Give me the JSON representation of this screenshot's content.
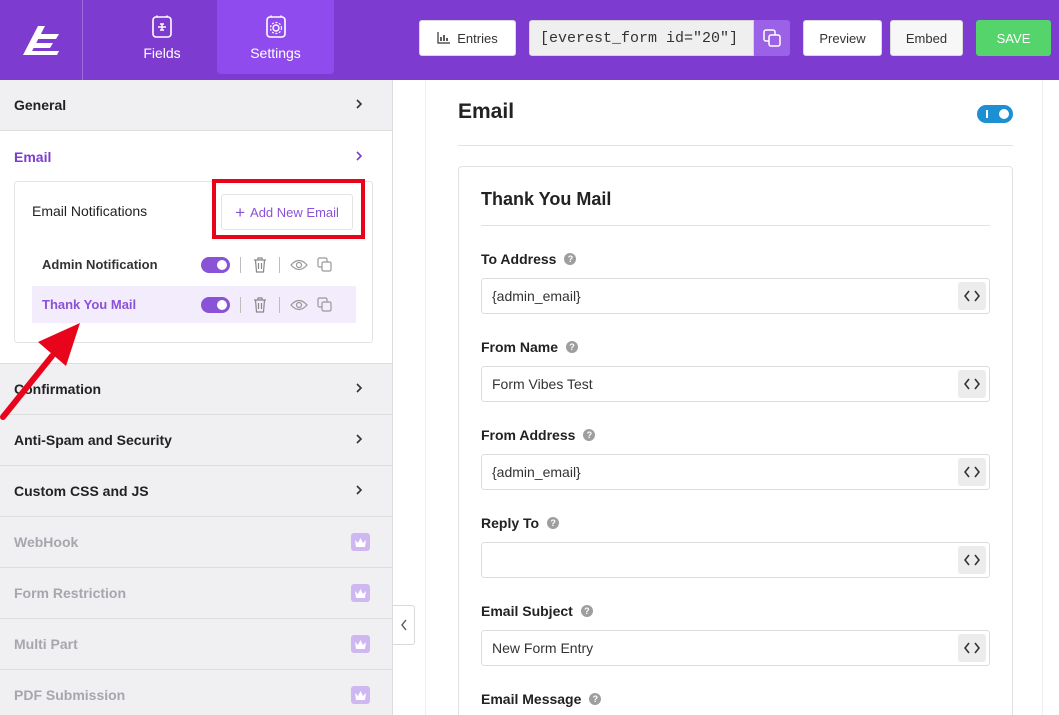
{
  "topbar": {
    "tabs": [
      {
        "label": "Fields",
        "icon": "form-fields-icon"
      },
      {
        "label": "Settings",
        "icon": "settings-doc-icon"
      }
    ],
    "entries_label": "Entries",
    "shortcode": "[everest_form id=\"20\"]",
    "preview_label": "Preview",
    "embed_label": "Embed",
    "save_label": "SAVE"
  },
  "sidebar": {
    "items": [
      {
        "label": "General"
      },
      {
        "label": "Email"
      },
      {
        "label": "Confirmation"
      },
      {
        "label": "Anti-Spam and Security"
      },
      {
        "label": "Custom CSS and JS"
      },
      {
        "label": "WebHook"
      },
      {
        "label": "Form Restriction"
      },
      {
        "label": "Multi Part"
      },
      {
        "label": "PDF Submission"
      }
    ],
    "email_notifications": {
      "title": "Email Notifications",
      "add_label": "Add New Email",
      "rows": [
        {
          "label": "Admin Notification",
          "enabled": true
        },
        {
          "label": "Thank You Mail",
          "enabled": true
        }
      ]
    }
  },
  "main": {
    "title": "Email",
    "enabled": true,
    "card": {
      "title": "Thank You Mail",
      "fields": [
        {
          "label": "To Address",
          "value": "{admin_email}"
        },
        {
          "label": "From Name",
          "value": "Form Vibes Test"
        },
        {
          "label": "From Address",
          "value": "{admin_email}"
        },
        {
          "label": "Reply To",
          "value": ""
        },
        {
          "label": "Email Subject",
          "value": "New Form Entry"
        },
        {
          "label": "Email Message"
        }
      ]
    }
  },
  "colors": {
    "brand_purple": "#7e3bd0",
    "active_tab": "#8f4bee",
    "save_green": "#54d46b",
    "toggle_blue": "#1c90d3",
    "highlight_red": "#e8051b"
  }
}
